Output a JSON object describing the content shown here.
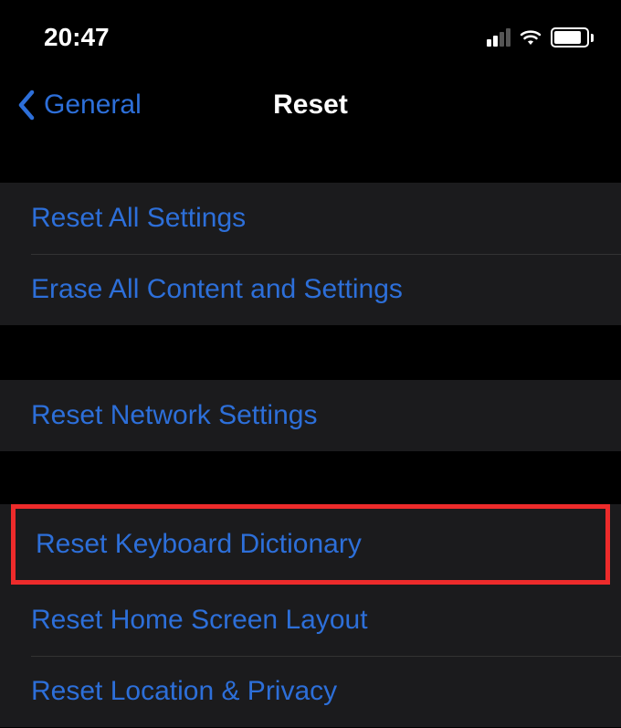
{
  "status": {
    "time": "20:47"
  },
  "nav": {
    "back_label": "General",
    "title": "Reset"
  },
  "groups": [
    {
      "items": [
        {
          "label": "Reset All Settings"
        },
        {
          "label": "Erase All Content and Settings"
        }
      ]
    },
    {
      "items": [
        {
          "label": "Reset Network Settings"
        }
      ]
    },
    {
      "items": [
        {
          "label": "Reset Keyboard Dictionary",
          "highlighted": true
        },
        {
          "label": "Reset Home Screen Layout"
        },
        {
          "label": "Reset Location & Privacy"
        }
      ]
    }
  ]
}
